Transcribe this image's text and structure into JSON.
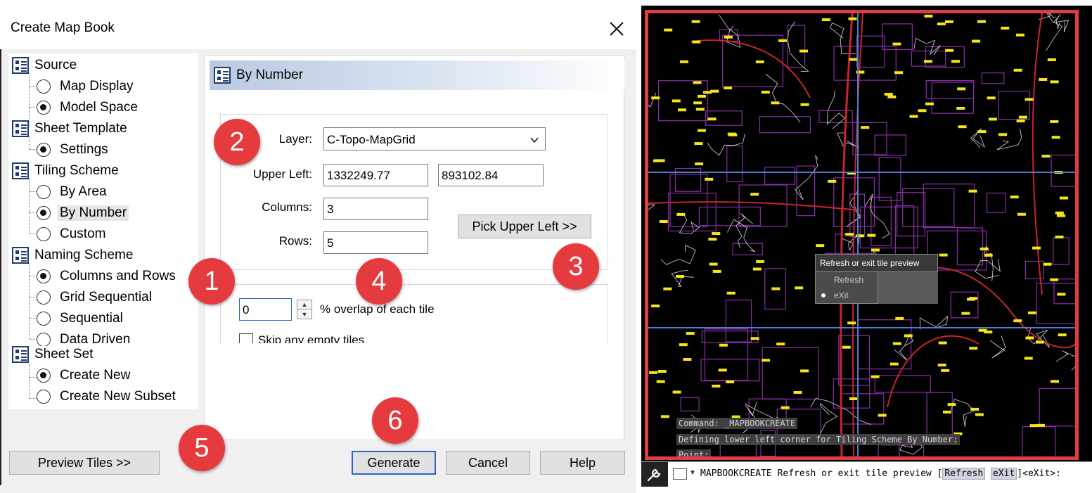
{
  "dialog": {
    "title": "Create Map Book",
    "tree": {
      "groups": [
        {
          "label": "Source",
          "items": [
            {
              "label": "Map Display",
              "checked": false
            },
            {
              "label": "Model Space",
              "checked": true
            }
          ]
        },
        {
          "label": "Sheet Template",
          "items": [
            {
              "label": "Settings",
              "checked": true
            }
          ]
        },
        {
          "label": "Tiling Scheme",
          "items": [
            {
              "label": "By Area",
              "checked": false
            },
            {
              "label": "By Number",
              "checked": true
            },
            {
              "label": "Custom",
              "checked": false
            }
          ]
        },
        {
          "label": "Naming Scheme",
          "items": [
            {
              "label": "Columns and Rows",
              "checked": true
            },
            {
              "label": "Grid Sequential",
              "checked": false
            },
            {
              "label": "Sequential",
              "checked": false
            },
            {
              "label": "Data Driven",
              "checked": false
            }
          ]
        },
        {
          "label": "Sheet Set",
          "items": [
            {
              "label": "Create New",
              "checked": true
            },
            {
              "label": "Create New Subset",
              "checked": false
            }
          ]
        }
      ]
    },
    "panel": {
      "title": "By Number",
      "layer_label": "Layer:",
      "layer_value": "C-Topo-MapGrid",
      "upper_left_label": "Upper Left:",
      "upper_left_x": "1332249.77",
      "upper_left_y": "893102.84",
      "columns_label": "Columns:",
      "columns_value": "3",
      "rows_label": "Rows:",
      "rows_value": "5",
      "pick_button": "Pick Upper Left >>",
      "overlap_value": "0",
      "overlap_label": "% overlap of each tile",
      "skip_label": "Skip any empty tiles"
    },
    "buttons": {
      "preview": "Preview Tiles >>",
      "generate": "Generate",
      "cancel": "Cancel",
      "help": "Help"
    },
    "badges": [
      "1",
      "2",
      "3",
      "4",
      "5",
      "6"
    ]
  },
  "map": {
    "tile_menu": {
      "title": "Refresh or exit tile preview",
      "items": [
        "Refresh",
        "eXit"
      ],
      "selected": "eXit"
    },
    "history": [
      "Command: _MAPBOOKCREATE",
      "Defining lower left corner for Tiling Scheme By Number:",
      "Point:"
    ],
    "command_prefix": "MAPBOOKCREATE Refresh or exit tile preview [",
    "command_opt1": "Refresh",
    "command_opt2": "eXit",
    "command_suffix": "]<eXit>:",
    "colors": {
      "frame": "#e03c44",
      "parcels": "#8a2fa8",
      "grid": "#4a7fd4",
      "labels": "#f5e61a",
      "roads": "#c8242e"
    }
  }
}
